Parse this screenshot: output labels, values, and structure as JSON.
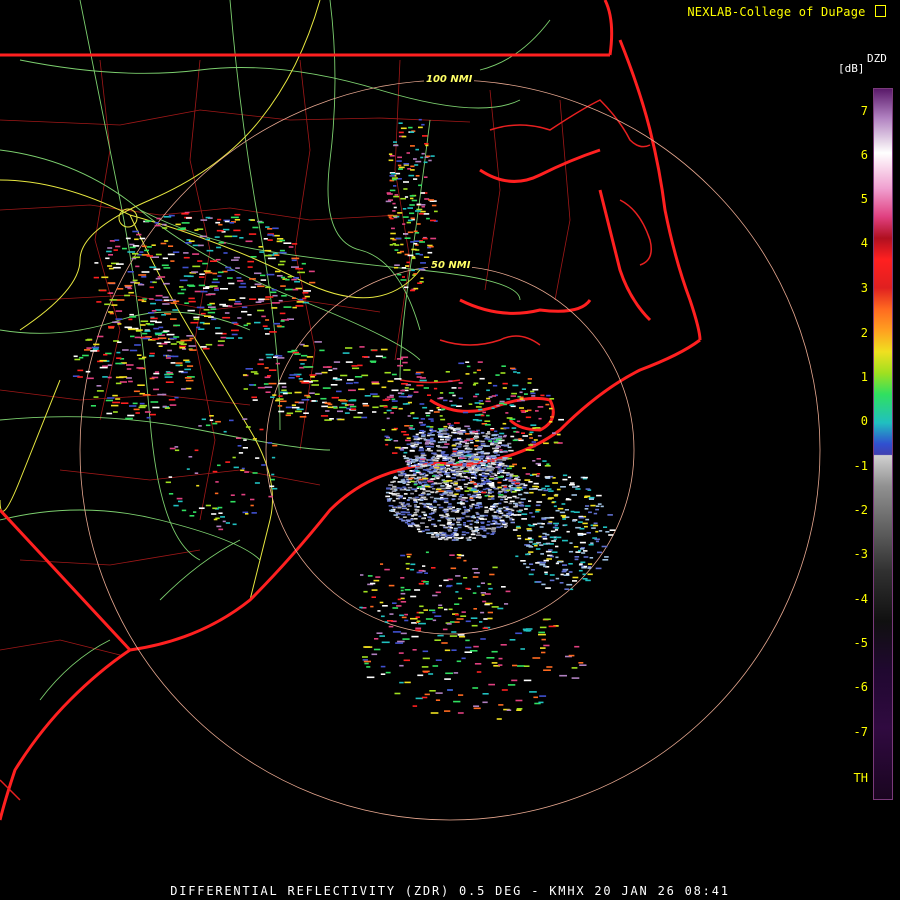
{
  "header": {
    "credit": "NEXLAB-College of DuPage"
  },
  "footer": {
    "caption": "DIFFERENTIAL REFLECTIVITY (ZDR) 0.5 DEG - KMHX 20 JAN 26 08:41"
  },
  "legend": {
    "product": "DZD",
    "unit": "[dB]",
    "ticks": [
      "7",
      "6",
      "5",
      "4",
      "3",
      "2",
      "1",
      "0",
      "-1",
      "-2",
      "-3",
      "-4",
      "-5",
      "-6",
      "-7",
      "TH"
    ]
  },
  "range_rings": {
    "inner_label": "50 NMI",
    "outer_label": "100 NMI"
  },
  "colors": {
    "state_border": "#ff2020",
    "county_border": "#aa1010",
    "highway": "#7ccf6e",
    "interstate": "#e8e840",
    "ring": "#e8a890",
    "background": "#000000"
  },
  "icons": {
    "credit_logo": "dupage-logo-icon"
  }
}
